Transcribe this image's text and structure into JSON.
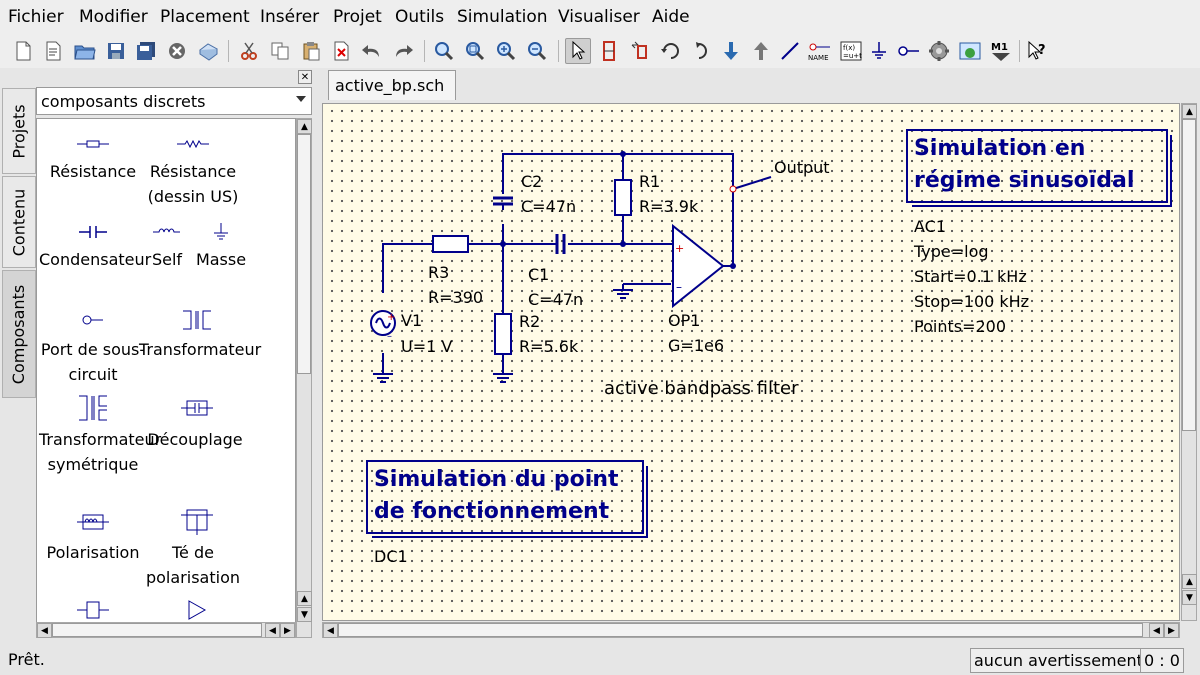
{
  "menu": [
    "Fichier",
    "Modifier",
    "Placement",
    "Insérer",
    "Projet",
    "Outils",
    "Simulation",
    "Visualiser",
    "Aide"
  ],
  "dock": {
    "tabs": [
      "Projets",
      "Contenu",
      "Composants"
    ],
    "combo_value": "composants discrets",
    "components": [
      {
        "label": "Résistance",
        "icon": "resistor-icon"
      },
      {
        "label": "Résistance (dessin US)",
        "icon": "resistor-us-icon"
      },
      {
        "label": "Condensateur",
        "icon": "capacitor-icon"
      },
      {
        "label": "Self",
        "icon": "inductor-icon"
      },
      {
        "label": "Masse",
        "icon": "ground-icon"
      },
      {
        "label": "Port de sous-circuit",
        "icon": "subcircuit-port-icon"
      },
      {
        "label": "Transformateur",
        "icon": "transformer-icon"
      },
      {
        "label": "Transformateur symétrique",
        "icon": "symmetric-transformer-icon"
      },
      {
        "label": "Découplage",
        "icon": "dc-block-icon"
      },
      {
        "label": "Polarisation",
        "icon": "dc-feed-icon"
      },
      {
        "label": "Té de polarisation",
        "icon": "bias-tee-icon"
      }
    ]
  },
  "document": {
    "tab": "active_bp.sch",
    "schematic": {
      "output_label": "Output",
      "title_text": "active bandpass filter",
      "parts": {
        "C2": {
          "name": "C2",
          "value": "C=47n"
        },
        "R1": {
          "name": "R1",
          "value": "R=3.9k"
        },
        "R3": {
          "name": "R3",
          "value": "R=390"
        },
        "C1": {
          "name": "C1",
          "value": "C=47n"
        },
        "R2": {
          "name": "R2",
          "value": "R=5.6k"
        },
        "V1": {
          "name": "V1",
          "value": "U=1 V"
        },
        "OP1": {
          "name": "OP1",
          "value": "G=1e6"
        }
      },
      "ac_sim": {
        "title": "Simulation en régime sinusoïdal",
        "name": "AC1",
        "params": [
          "Type=log",
          "Start=0.1 kHz",
          "Stop=100 kHz",
          "Points=200"
        ]
      },
      "dc_sim": {
        "title": "Simulation du point de fonctionnement",
        "name": "DC1"
      }
    }
  },
  "status": {
    "left": "Prêt.",
    "warnings": "aucun avertissement",
    "position": "0 : 0"
  },
  "colors": {
    "wire": "#00008b",
    "canvas": "#fffbe6",
    "text_box": "#00008b"
  }
}
